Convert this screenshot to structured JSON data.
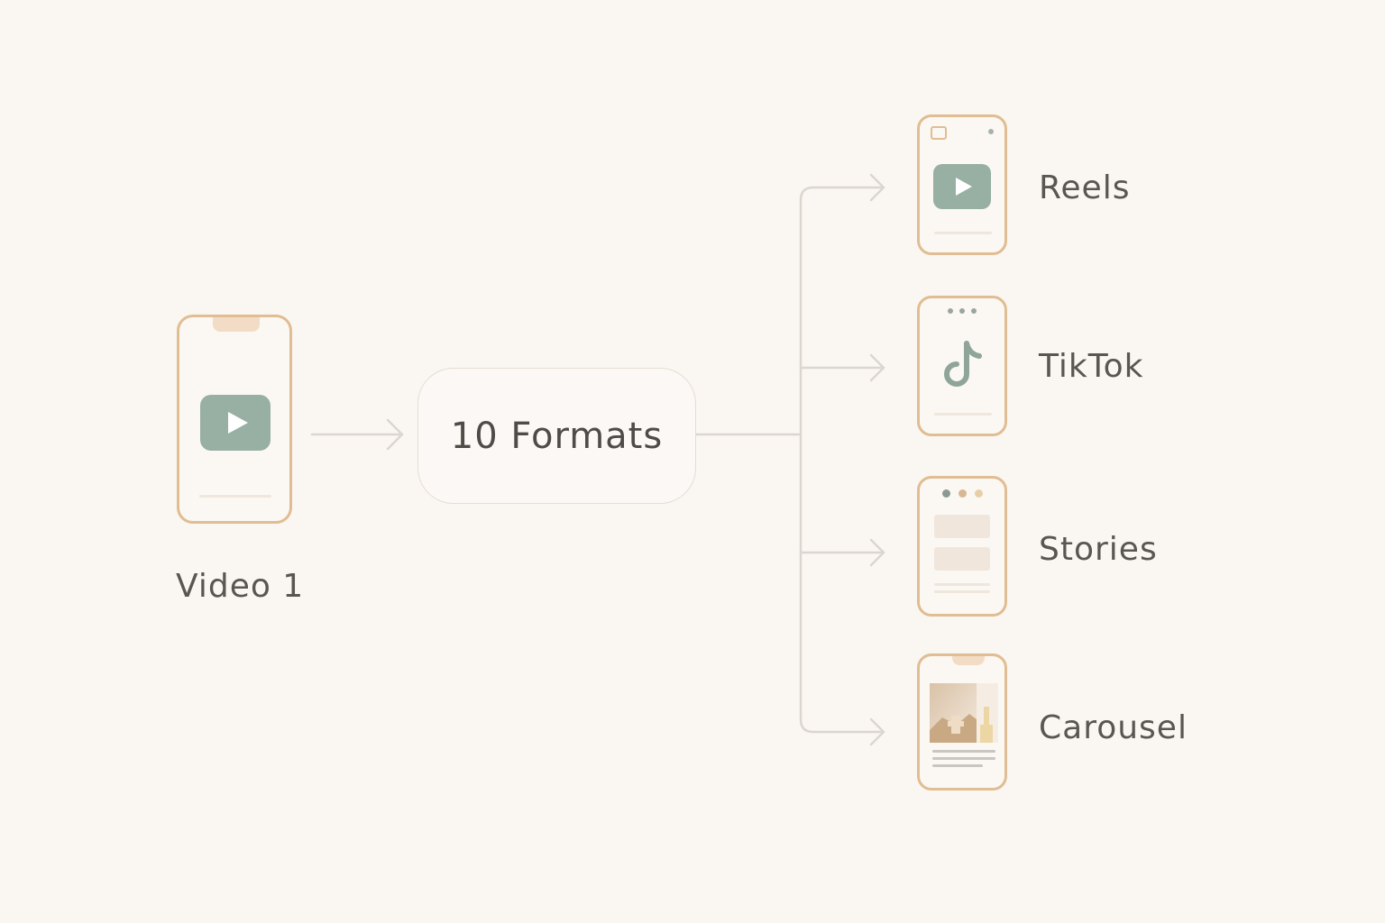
{
  "source": {
    "label": "Video 1",
    "icon": "play-icon"
  },
  "center": {
    "label": "10 Formats"
  },
  "outputs": [
    {
      "label": "Reels",
      "icon": "reels-phone-icon"
    },
    {
      "label": "TikTok",
      "icon": "tiktok-icon"
    },
    {
      "label": "Stories",
      "icon": "stories-phone-icon"
    },
    {
      "label": "Carousel",
      "icon": "carousel-phone-icon"
    }
  ],
  "colors": {
    "background": "#faf6f2",
    "phone_border": "#e0bd92",
    "accent_green": "#98afa3",
    "connector": "#dcd6cf",
    "text": "#5a5651"
  }
}
